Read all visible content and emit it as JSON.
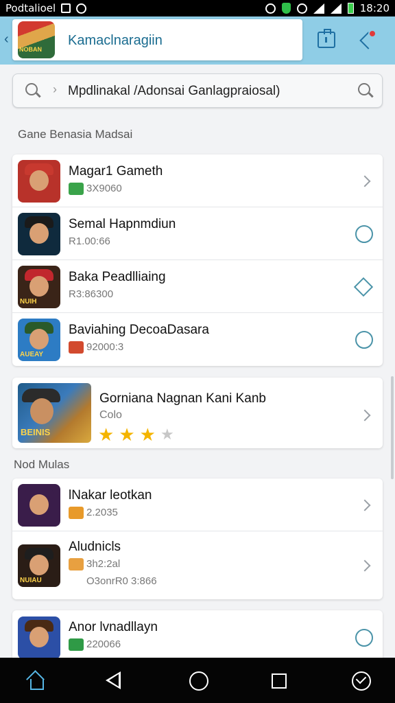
{
  "status_bar": {
    "carrier": "Podtalioel",
    "time": "18:20"
  },
  "header": {
    "back": "‹",
    "title": "Kamaclnaragiin",
    "logo_text": "NOBAN"
  },
  "search": {
    "query": "Mpdlinakal /Adonsai Ganlagpraiosal)",
    "chevron": "›"
  },
  "section1": {
    "label": "Gane Benasia Madsai"
  },
  "list1": [
    {
      "name": "Magar1 Gameth",
      "sub": "3X9060",
      "action": "chevron",
      "thumb_bg": "#b8322a",
      "hat": "#c8392f",
      "thumb_text": "",
      "mini_color": "#3aa34a"
    },
    {
      "name": "Semal Hapnmdiun",
      "sub": "R1.00:66",
      "action": "circle",
      "thumb_bg": "#0f2a3d",
      "hat": "#1a1a1a",
      "thumb_text": "",
      "mini_color": ""
    },
    {
      "name": "Baka Peadlliaing",
      "sub": "R3:86300",
      "action": "diamond",
      "thumb_bg": "#3a2418",
      "hat": "#c1272d",
      "thumb_text": "NUIH",
      "mini_color": ""
    },
    {
      "name": "Baviahing DecoaDasara",
      "sub": "92000:3",
      "action": "circle",
      "thumb_bg": "#2d7cc4",
      "hat": "#2a5a2a",
      "thumb_text": "AUEAY",
      "mini_color": "#d24a2e"
    }
  ],
  "featured": {
    "name": "Gorniana Nagnan Kani Kanb",
    "sub": "Colo",
    "thumb_text": "BEINIS",
    "stars": [
      "★",
      "★",
      "★",
      "★"
    ],
    "rating": 3
  },
  "section2": {
    "label": "Nod Mulas"
  },
  "list2": [
    {
      "name": "lNakar leotkan",
      "sub": "2.2035",
      "action": "chevron",
      "thumb_bg": "#3a1d4a",
      "hat": "#3a1d4a",
      "thumb_text": "",
      "mini_color": "#e89a2a"
    },
    {
      "name": "Aludnicls",
      "sub": "3h2:2al",
      "sub2": "O3onrR0 3:866",
      "action": "chevron",
      "thumb_bg": "#2a1d16",
      "hat": "#1e1e1e",
      "thumb_text": "NUIAU",
      "mini_color": "#e8a040"
    }
  ],
  "list3": [
    {
      "name": "Anor lvnadllayn",
      "sub": "220066",
      "action": "circle",
      "thumb_bg": "#2c4fa6",
      "hat": "#4a2a14",
      "thumb_text": "",
      "mini_color": "#2f9a46"
    }
  ]
}
